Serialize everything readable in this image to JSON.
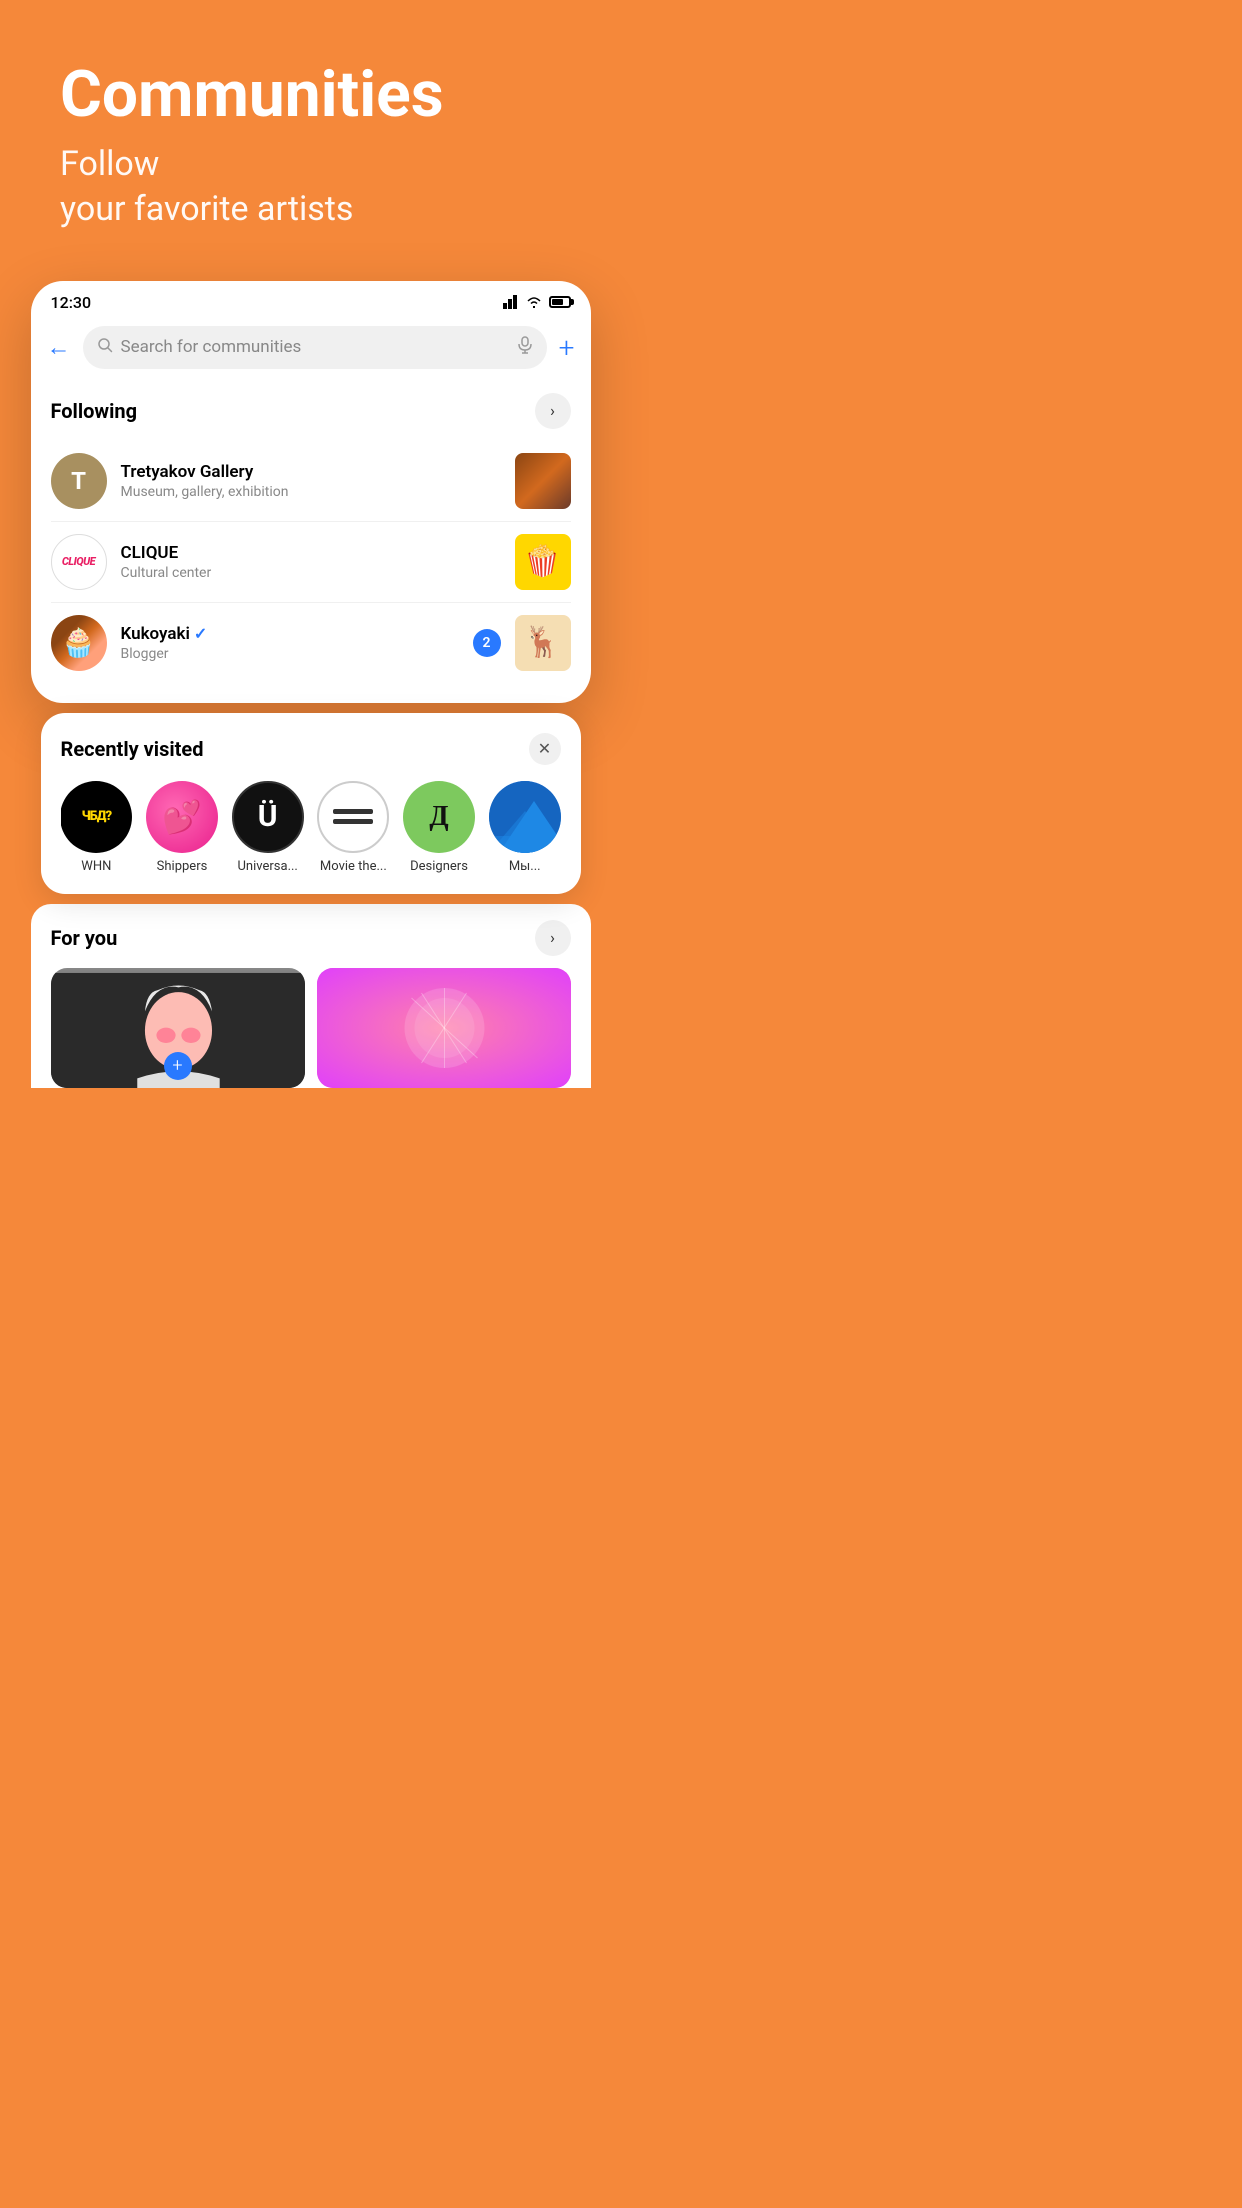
{
  "hero": {
    "title": "Communities",
    "subtitle_line1": "Follow",
    "subtitle_line2": "your favorite artists"
  },
  "status_bar": {
    "time": "12:30"
  },
  "search": {
    "placeholder": "Search for communities"
  },
  "following": {
    "section_label": "Following",
    "items": [
      {
        "name": "Tretyakov Gallery",
        "type": "Museum, gallery, exhibition",
        "avatar_letter": "T",
        "verified": false,
        "badge": null
      },
      {
        "name": "CLIQUE",
        "type": "Cultural center",
        "avatar_text": "CLIQUE",
        "verified": false,
        "badge": null
      },
      {
        "name": "Kukoyaki",
        "type": "Blogger",
        "verified": true,
        "badge": "2"
      }
    ]
  },
  "recently_visited": {
    "section_label": "Recently visited",
    "items": [
      {
        "label": "WHN",
        "avatar_type": "whn"
      },
      {
        "label": "Shippers",
        "avatar_type": "shippers"
      },
      {
        "label": "Universa...",
        "avatar_type": "universal"
      },
      {
        "label": "Movie the...",
        "avatar_type": "moviethe"
      },
      {
        "label": "Designers",
        "avatar_type": "designers"
      },
      {
        "label": "Мы...",
        "avatar_type": "mbi"
      }
    ]
  },
  "for_you": {
    "section_label": "For you"
  },
  "icons": {
    "back_arrow": "←",
    "chevron_right": "›",
    "close": "✕",
    "add": "+",
    "verified_check": "✓"
  }
}
